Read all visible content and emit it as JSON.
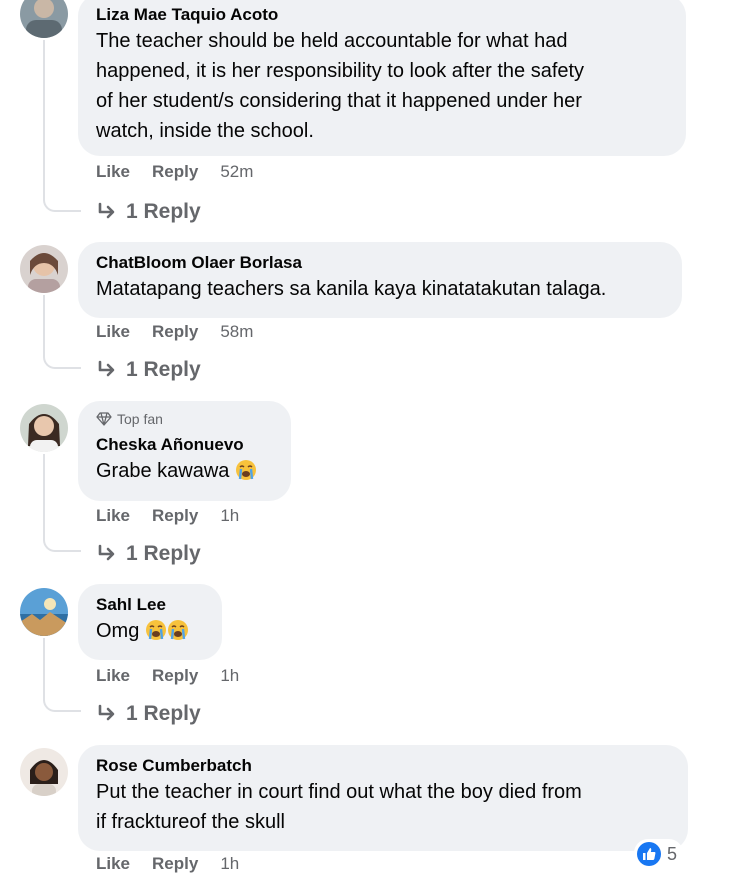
{
  "comments": [
    {
      "author": "Liza Mae Taquio Acoto",
      "lines": [
        "The teacher should be held accountable for what had",
        "happened, it is her responsibility to look after the safety",
        "of her student/s considering that it happened under her",
        "watch, inside the school."
      ],
      "like": "Like",
      "reply": "Reply",
      "time": "52m",
      "replies": "1 Reply"
    },
    {
      "author": "ChatBloom Olaer Borlasa",
      "lines": [
        "Matatapang teachers sa kanila kaya kinatatakutan talaga."
      ],
      "like": "Like",
      "reply": "Reply",
      "time": "58m",
      "replies": "1 Reply"
    },
    {
      "badge": "Top fan",
      "author": "Cheska Añonuevo",
      "lines": [
        "Grabe kawawa"
      ],
      "like": "Like",
      "reply": "Reply",
      "time": "1h",
      "replies": "1 Reply"
    },
    {
      "author": "Sahl Lee",
      "lines": [
        "Omg"
      ],
      "like": "Like",
      "reply": "Reply",
      "time": "1h",
      "replies": "1 Reply"
    },
    {
      "author": "Rose Cumberbatch",
      "lines": [
        "Put the teacher in court find out what the boy died from",
        "if fracktureof the skull"
      ],
      "like": "Like",
      "reply": "Reply",
      "time": "1h",
      "reaction_count": "5"
    }
  ],
  "colors": {
    "bubble": "#eff1f4",
    "secondary_text": "#65676b",
    "like_blue": "#1877f2"
  },
  "icons": {
    "reply_arrow": "reply-arrow-icon",
    "top_fan": "diamond-icon",
    "emoji": "crying-face-emoji",
    "reaction": "like-thumb-icon"
  }
}
